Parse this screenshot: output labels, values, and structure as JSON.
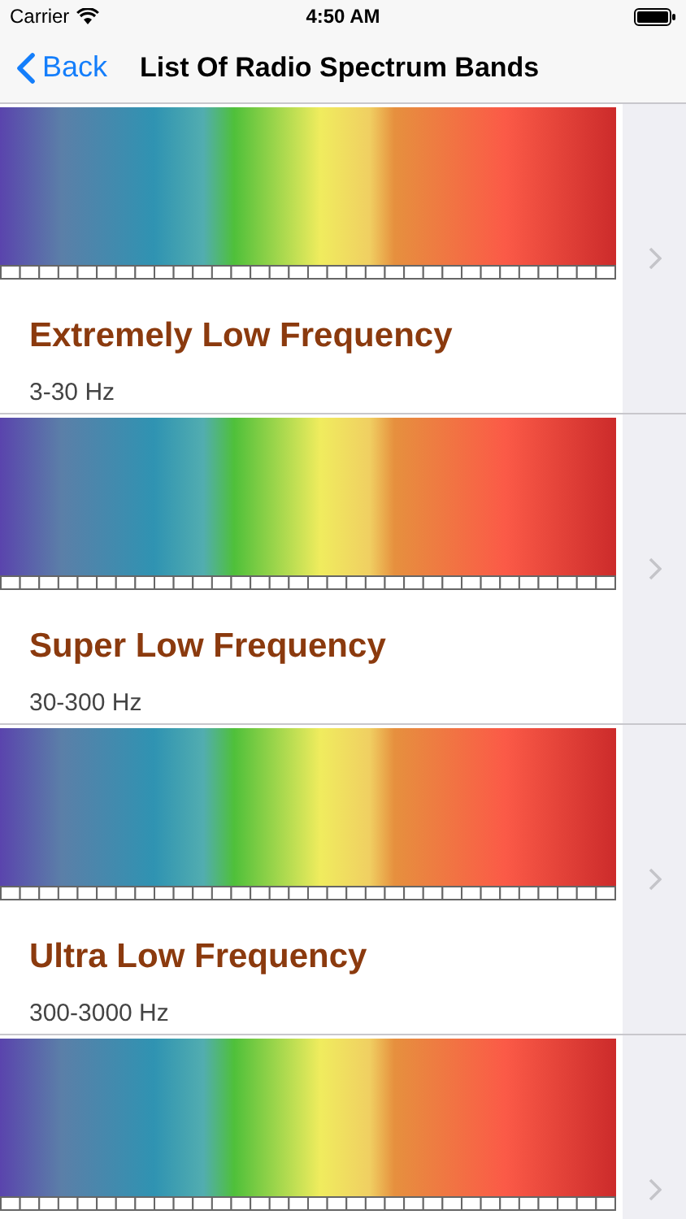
{
  "status_bar": {
    "carrier": "Carrier",
    "time": "4:50 AM"
  },
  "nav": {
    "back": "Back",
    "title": "List Of Radio Spectrum Bands"
  },
  "bands": [
    {
      "kind": "full",
      "title": "Extremely Low Frequency",
      "range": "3-30 Hz"
    },
    {
      "kind": "full",
      "title": "Super Low Frequency",
      "range": "30-300 Hz"
    },
    {
      "kind": "full",
      "title": "Ultra Low Frequency",
      "range": "300-3000 Hz"
    },
    {
      "kind": "cut"
    }
  ]
}
